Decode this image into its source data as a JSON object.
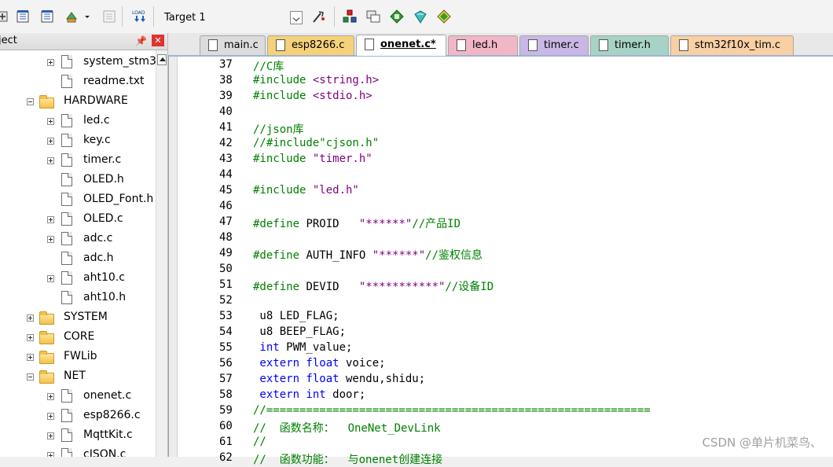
{
  "toolbar": {
    "target": "Target 1"
  },
  "project_panel": {
    "title": "ject",
    "items": [
      {
        "label": "system_stm3",
        "kind": "file",
        "exp": "plus",
        "indent": 2
      },
      {
        "label": "readme.txt",
        "kind": "file",
        "exp": "",
        "indent": 2
      },
      {
        "label": "HARDWARE",
        "kind": "folder",
        "exp": "minus",
        "indent": 1
      },
      {
        "label": "led.c",
        "kind": "file",
        "exp": "plus",
        "indent": 2
      },
      {
        "label": "key.c",
        "kind": "file",
        "exp": "plus",
        "indent": 2
      },
      {
        "label": "timer.c",
        "kind": "file",
        "exp": "plus",
        "indent": 2
      },
      {
        "label": "OLED.h",
        "kind": "file",
        "exp": "",
        "indent": 2
      },
      {
        "label": "OLED_Font.h",
        "kind": "file",
        "exp": "",
        "indent": 2
      },
      {
        "label": "OLED.c",
        "kind": "file",
        "exp": "plus",
        "indent": 2
      },
      {
        "label": "adc.c",
        "kind": "file",
        "exp": "plus",
        "indent": 2
      },
      {
        "label": "adc.h",
        "kind": "file",
        "exp": "",
        "indent": 2
      },
      {
        "label": "aht10.c",
        "kind": "file",
        "exp": "plus",
        "indent": 2
      },
      {
        "label": "aht10.h",
        "kind": "file",
        "exp": "",
        "indent": 2
      },
      {
        "label": "SYSTEM",
        "kind": "folder",
        "exp": "plus",
        "indent": 1
      },
      {
        "label": "CORE",
        "kind": "folder",
        "exp": "plus",
        "indent": 1
      },
      {
        "label": "FWLib",
        "kind": "folder",
        "exp": "plus",
        "indent": 1
      },
      {
        "label": "NET",
        "kind": "folder",
        "exp": "minus",
        "indent": 1
      },
      {
        "label": "onenet.c",
        "kind": "file",
        "exp": "plus",
        "indent": 2
      },
      {
        "label": "esp8266.c",
        "kind": "file",
        "exp": "plus",
        "indent": 2
      },
      {
        "label": "MqttKit.c",
        "kind": "file",
        "exp": "plus",
        "indent": 2
      },
      {
        "label": "cJSON.c",
        "kind": "file",
        "exp": "plus",
        "indent": 2
      }
    ]
  },
  "tabs": [
    {
      "label": "main.c",
      "color": "#dcdcdc",
      "icon": "#ffffff",
      "active": false
    },
    {
      "label": "esp8266.c",
      "color": "#f5d27a",
      "icon": "#ffffff",
      "active": false
    },
    {
      "label": "onenet.c*",
      "color": "#ffffff",
      "icon": "#ffffff",
      "active": true
    },
    {
      "label": "led.h",
      "color": "#f2b7c6",
      "icon": "#ffffff",
      "active": false
    },
    {
      "label": "timer.c",
      "color": "#c9b8e6",
      "icon": "#ffffff",
      "active": false
    },
    {
      "label": "timer.h",
      "color": "#a6d3c5",
      "icon": "#ffffff",
      "active": false
    },
    {
      "label": "stm32f10x_tim.c",
      "color": "#f9cfa4",
      "icon": "#ffffff",
      "active": false
    }
  ],
  "code_lines": [
    {
      "n": "37",
      "t": [
        [
          "c",
          "//C库"
        ]
      ]
    },
    {
      "n": "38",
      "t": [
        [
          "pp",
          "#include "
        ],
        [
          "s",
          "<string.h>"
        ]
      ]
    },
    {
      "n": "39",
      "t": [
        [
          "pp",
          "#include "
        ],
        [
          "s",
          "<stdio.h>"
        ]
      ]
    },
    {
      "n": "40",
      "t": []
    },
    {
      "n": "41",
      "t": [
        [
          "c",
          "//json库"
        ]
      ]
    },
    {
      "n": "42",
      "t": [
        [
          "c",
          "//#include\"cjson.h\""
        ]
      ]
    },
    {
      "n": "43",
      "t": [
        [
          "pp",
          "#include "
        ],
        [
          "s",
          "\"timer.h\""
        ]
      ]
    },
    {
      "n": "44",
      "t": []
    },
    {
      "n": "45",
      "t": [
        [
          "pp",
          "#include "
        ],
        [
          "s",
          "\"led.h\""
        ]
      ]
    },
    {
      "n": "46",
      "t": []
    },
    {
      "n": "47",
      "t": [
        [
          "pp",
          "#define "
        ],
        [
          "n",
          "PROID   "
        ],
        [
          "s",
          "\"******\""
        ],
        [
          "c",
          "//产品ID"
        ]
      ]
    },
    {
      "n": "48",
      "t": []
    },
    {
      "n": "49",
      "t": [
        [
          "pp",
          "#define "
        ],
        [
          "n",
          "AUTH_INFO "
        ],
        [
          "s",
          "\"******\""
        ],
        [
          "c",
          "//鉴权信息"
        ]
      ]
    },
    {
      "n": "50",
      "t": []
    },
    {
      "n": "51",
      "t": [
        [
          "pp",
          "#define "
        ],
        [
          "n",
          "DEVID   "
        ],
        [
          "s",
          "\"***********\""
        ],
        [
          "c",
          "//设备ID"
        ]
      ]
    },
    {
      "n": "52",
      "t": []
    },
    {
      "n": "53",
      "t": [
        [
          "n",
          " u8 LED_FLAG;"
        ]
      ]
    },
    {
      "n": "54",
      "t": [
        [
          "n",
          " u8 BEEP_FLAG;"
        ]
      ]
    },
    {
      "n": "55",
      "t": [
        [
          "k",
          " int"
        ],
        [
          "n",
          " PWM_value;"
        ]
      ]
    },
    {
      "n": "56",
      "t": [
        [
          "k",
          " extern float"
        ],
        [
          "n",
          " voice;"
        ]
      ]
    },
    {
      "n": "57",
      "t": [
        [
          "k",
          " extern float"
        ],
        [
          "n",
          " wendu,shidu;"
        ]
      ]
    },
    {
      "n": "58",
      "t": [
        [
          "k",
          " extern int"
        ],
        [
          "n",
          " door;"
        ]
      ]
    },
    {
      "n": "59",
      "t": [
        [
          "c",
          "//=========================================================="
        ]
      ]
    },
    {
      "n": "60",
      "t": [
        [
          "c",
          "//  函数名称：  OneNet_DevLink"
        ]
      ]
    },
    {
      "n": "61",
      "t": [
        [
          "c",
          "//"
        ]
      ]
    },
    {
      "n": "62",
      "t": [
        [
          "c",
          "//  函数功能：  与onenet创建连接"
        ]
      ]
    }
  ],
  "watermark": "CSDN @单片机菜鸟、"
}
